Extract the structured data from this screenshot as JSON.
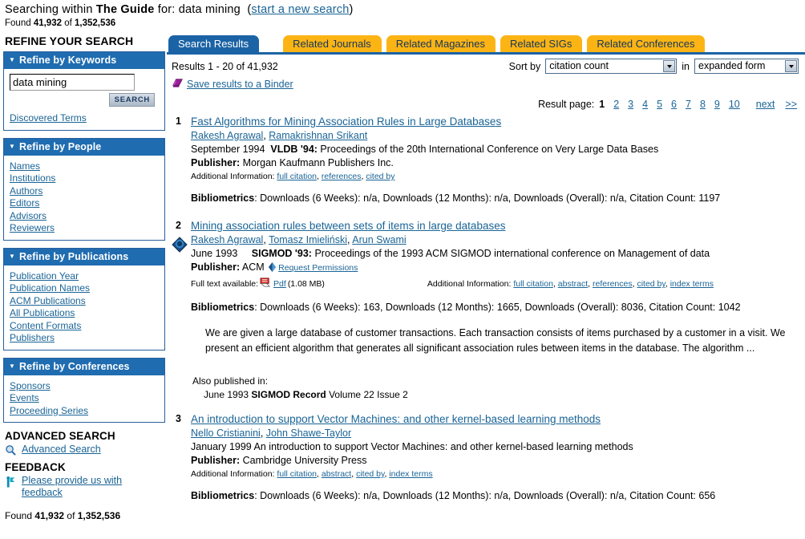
{
  "header": {
    "searching_prefix": "Searching within ",
    "scope": "The Guide",
    "for_label": " for: ",
    "query": "data mining",
    "open_paren": "(",
    "new_search_link": "start a new search",
    "close_paren": ")",
    "found_prefix": "Found ",
    "found_count": "41,932",
    "found_of": " of ",
    "found_total": "1,352,536"
  },
  "sidebar": {
    "title": "REFINE YOUR SEARCH",
    "keywords_panel": {
      "heading": "Refine by Keywords",
      "input_value": "data mining",
      "input_placeholder": "",
      "search_button": "SEARCH",
      "link": "Discovered Terms"
    },
    "people_panel": {
      "heading": "Refine by People",
      "items": [
        "Names",
        "Institutions",
        "Authors",
        "Editors",
        "Advisors",
        "Reviewers"
      ]
    },
    "publications_panel": {
      "heading": "Refine by Publications",
      "items": [
        "Publication Year",
        "Publication Names",
        "ACM Publications",
        "All Publications",
        "Content Formats",
        "Publishers"
      ]
    },
    "conferences_panel": {
      "heading": "Refine by Conferences",
      "items": [
        "Sponsors",
        "Events",
        "Proceeding Series"
      ]
    },
    "advanced": {
      "heading": "ADVANCED SEARCH",
      "link": "Advanced Search",
      "icon": "magnifier-icon"
    },
    "feedback": {
      "heading": "FEEDBACK",
      "link": "Please provide us with feedback",
      "icon": "feedback-icon"
    },
    "found_bottom": {
      "prefix": "Found ",
      "count": "41,932",
      "of": " of ",
      "total": "1,352,536"
    }
  },
  "tabs": [
    {
      "label": "Search Results",
      "active": true
    },
    {
      "label": "Related Journals",
      "active": false
    },
    {
      "label": "Related Magazines",
      "active": false
    },
    {
      "label": "Related SIGs",
      "active": false
    },
    {
      "label": "Related Conferences",
      "active": false
    }
  ],
  "results_header": {
    "count_text": "Results 1 - 20 of 41,932",
    "sort_by_label": "Sort by",
    "sort_value": "citation count",
    "in_label": "in",
    "form_value": "expanded form",
    "binder_link": "Save results to a Binder",
    "binder_icon": "binder-icon"
  },
  "pagination": {
    "label": "Result page:",
    "current": "1",
    "pages": [
      "2",
      "3",
      "4",
      "5",
      "6",
      "7",
      "8",
      "9",
      "10"
    ],
    "next": "next",
    "last": ">>"
  },
  "results": [
    {
      "number": "1",
      "title": "Fast Algorithms for Mining Association Rules in Large Databases",
      "authors": [
        "Rakesh Agrawal",
        "Ramakrishnan Srikant"
      ],
      "date": "September 1994",
      "venue_short": "VLDB '94:",
      "venue_rest": " Proceedings of the 20th International Conference on Very Large Data Bases",
      "publisher_label": "Publisher:",
      "publisher": " Morgan Kaufmann Publishers Inc.",
      "additional_label": "Additional Information:",
      "additional_links": [
        "full citation",
        "references",
        "cited by"
      ],
      "bibliometrics_label": "Bibliometrics",
      "bibliometrics": ": Downloads (6 Weeks): n/a,   Downloads (12 Months): n/a,   Downloads (Overall): n/a,    Citation Count: 1197",
      "has_acm_badge": false,
      "has_fulltext": false
    },
    {
      "number": "2",
      "title": "Mining association rules between sets of items in large databases",
      "authors": [
        "Rakesh Agrawal",
        "Tomasz Imieliński",
        "Arun Swami"
      ],
      "date": "June 1993",
      "venue_short": "SIGMOD '93:",
      "venue_rest": " Proceedings of the 1993 ACM SIGMOD international conference on Management of data",
      "publisher_label": "Publisher:",
      "publisher": " ACM ",
      "permissions_link": "Request Permissions",
      "fulltext_label": "Full text available:",
      "fulltext_link": "Pdf",
      "fulltext_size": " (1.08 MB)",
      "additional_label": "Additional Information:",
      "additional_links": [
        "full citation",
        "abstract",
        "references",
        "cited by",
        "index terms"
      ],
      "bibliometrics_label": "Bibliometrics",
      "bibliometrics": ": Downloads (6 Weeks): 163,   Downloads (12 Months): 1665,   Downloads (Overall): 8036,    Citation Count: 1042",
      "abstract": "We are given a large database of customer transactions. Each transaction consists of items purchased by a customer in a visit. We present an efficient algorithm that generates all significant association rules between items in the database. The algorithm ...",
      "also_published_label": "Also published in:",
      "also_published_date": "June 1993 ",
      "also_published_name": "SIGMOD Record",
      "also_published_rest": " Volume 22 Issue 2",
      "has_acm_badge": true,
      "has_fulltext": true
    },
    {
      "number": "3",
      "title": "An introduction to support Vector Machines: and other kernel-based learning methods",
      "authors": [
        "Nello Cristianini",
        "John Shawe-Taylor"
      ],
      "date": "January 1999",
      "venue_short": "",
      "venue_rest": " An introduction to support Vector Machines: and other kernel-based learning methods",
      "publisher_label": "Publisher:",
      "publisher": " Cambridge University Press",
      "additional_label": "Additional Information:",
      "additional_links": [
        "full citation",
        "abstract",
        "cited by",
        "index terms"
      ],
      "bibliometrics_label": "Bibliometrics",
      "bibliometrics": ": Downloads (6 Weeks): n/a,   Downloads (12 Months): n/a,   Downloads (Overall): n/a,    Citation Count: 656",
      "has_acm_badge": false,
      "has_fulltext": false
    }
  ],
  "colors": {
    "link": "#1a6496",
    "panel_header": "#1f6cb0",
    "tab_active": "#1b63a5",
    "tab_inactive": "#fcb415",
    "binder_purple": "#9b1f9b"
  }
}
